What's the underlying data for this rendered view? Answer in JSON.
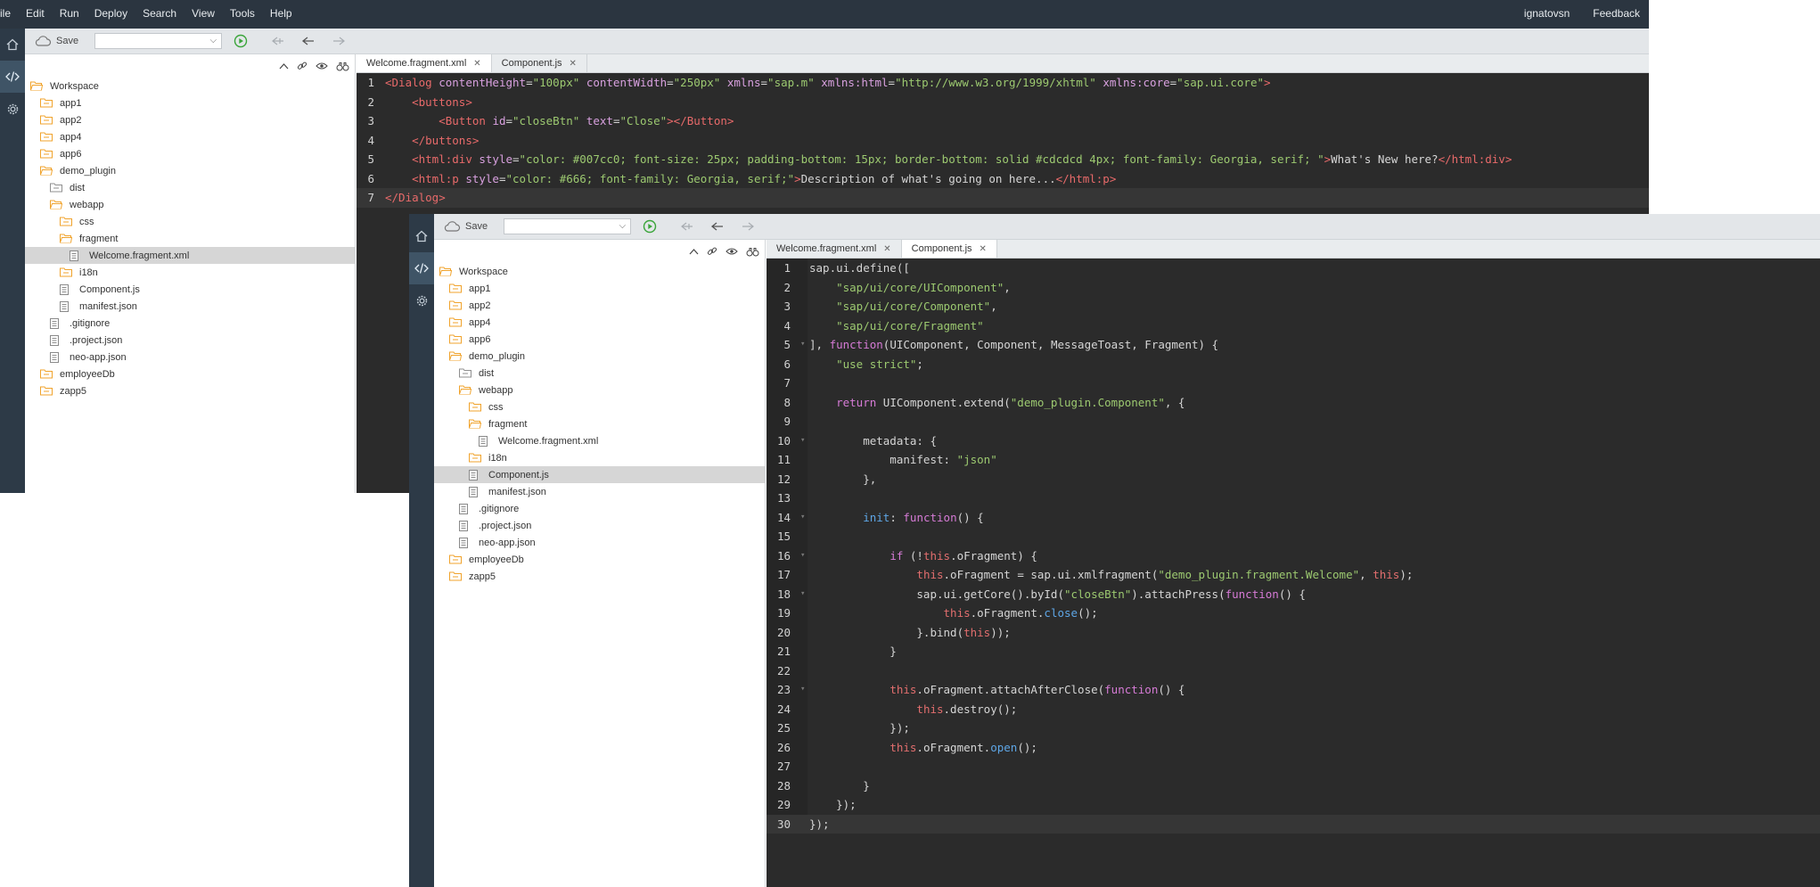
{
  "menubar": {
    "items": [
      "ile",
      "Edit",
      "Run",
      "Deploy",
      "Search",
      "View",
      "Tools",
      "Help"
    ],
    "user": "ignatovsn",
    "feedback": "Feedback"
  },
  "toolbar": {
    "save_label": "Save"
  },
  "tree": [
    {
      "label": "Workspace",
      "type": "folder-open",
      "level": 0
    },
    {
      "label": "app1",
      "type": "folder",
      "level": 1
    },
    {
      "label": "app2",
      "type": "folder",
      "level": 1
    },
    {
      "label": "app4",
      "type": "folder",
      "level": 1
    },
    {
      "label": "app6",
      "type": "folder",
      "level": 1
    },
    {
      "label": "demo_plugin",
      "type": "folder-open",
      "level": 1
    },
    {
      "label": "dist",
      "type": "folder-gray",
      "level": 2
    },
    {
      "label": "webapp",
      "type": "folder-open",
      "level": 2
    },
    {
      "label": "css",
      "type": "folder",
      "level": 3
    },
    {
      "label": "fragment",
      "type": "folder-open",
      "level": 3
    },
    {
      "label": "Welcome.fragment.xml",
      "type": "file",
      "level": 4
    },
    {
      "label": "i18n",
      "type": "folder",
      "level": 3
    },
    {
      "label": "Component.js",
      "type": "file",
      "level": 3
    },
    {
      "label": "manifest.json",
      "type": "file",
      "level": 3
    },
    {
      "label": ".gitignore",
      "type": "file",
      "level": 2
    },
    {
      "label": ".project.json",
      "type": "file",
      "level": 2
    },
    {
      "label": "neo-app.json",
      "type": "file",
      "level": 2
    },
    {
      "label": "employeeDb",
      "type": "folder",
      "level": 1
    },
    {
      "label": "zapp5",
      "type": "folder",
      "level": 1
    }
  ],
  "window1": {
    "selected_tree_index": 10,
    "tabs": [
      {
        "label": "Welcome.fragment.xml",
        "active": true
      },
      {
        "label": "Component.js",
        "active": false
      }
    ],
    "current_line": 7,
    "code": [
      [
        [
          "tag",
          "<Dialog "
        ],
        [
          "attr",
          "contentHeight"
        ],
        [
          "plain",
          "="
        ],
        [
          "str",
          "\"100px\""
        ],
        [
          "plain",
          " "
        ],
        [
          "attr",
          "contentWidth"
        ],
        [
          "plain",
          "="
        ],
        [
          "str",
          "\"250px\""
        ],
        [
          "plain",
          " "
        ],
        [
          "attr",
          "xmlns"
        ],
        [
          "plain",
          "="
        ],
        [
          "str",
          "\"sap.m\""
        ],
        [
          "plain",
          " "
        ],
        [
          "attr",
          "xmlns:html"
        ],
        [
          "plain",
          "="
        ],
        [
          "str",
          "\"http://www.w3.org/1999/xhtml\""
        ],
        [
          "plain",
          " "
        ],
        [
          "attr",
          "xmlns:core"
        ],
        [
          "plain",
          "="
        ],
        [
          "str",
          "\"sap.ui.core\""
        ],
        [
          "tag",
          ">"
        ]
      ],
      [
        [
          "plain",
          "    "
        ],
        [
          "tag",
          "<buttons>"
        ]
      ],
      [
        [
          "plain",
          "        "
        ],
        [
          "tag",
          "<Button "
        ],
        [
          "attr",
          "id"
        ],
        [
          "plain",
          "="
        ],
        [
          "str",
          "\"closeBtn\""
        ],
        [
          "plain",
          " "
        ],
        [
          "attr",
          "text"
        ],
        [
          "plain",
          "="
        ],
        [
          "str",
          "\"Close\""
        ],
        [
          "tag",
          "></Button>"
        ]
      ],
      [
        [
          "plain",
          "    "
        ],
        [
          "tag",
          "</buttons>"
        ]
      ],
      [
        [
          "plain",
          "    "
        ],
        [
          "tag",
          "<html:div "
        ],
        [
          "attr",
          "style"
        ],
        [
          "plain",
          "="
        ],
        [
          "str",
          "\"color: #007cc0; font-size: 25px; padding-bottom: 15px; border-bottom: solid #cdcdcd 4px; font-family: Georgia, serif; \""
        ],
        [
          "tag",
          ">"
        ],
        [
          "plain",
          "What's New here?"
        ],
        [
          "tag",
          "</html:div>"
        ]
      ],
      [
        [
          "plain",
          "    "
        ],
        [
          "tag",
          "<html:p "
        ],
        [
          "attr",
          "style"
        ],
        [
          "plain",
          "="
        ],
        [
          "str",
          "\"color: #666; font-family: Georgia, serif;\""
        ],
        [
          "tag",
          ">"
        ],
        [
          "plain",
          "Description of what's going on here..."
        ],
        [
          "tag",
          "</html:p>"
        ]
      ],
      [
        [
          "tag",
          "</Dialog>"
        ]
      ]
    ]
  },
  "window2": {
    "selected_tree_index": 12,
    "tabs": [
      {
        "label": "Welcome.fragment.xml",
        "active": false
      },
      {
        "label": "Component.js",
        "active": true
      }
    ],
    "current_line": 30,
    "code": [
      [
        [
          "plain",
          "sap.ui.define(["
        ]
      ],
      [
        [
          "plain",
          "    "
        ],
        [
          "str",
          "\"sap/ui/core/UIComponent\""
        ],
        [
          "plain",
          ","
        ]
      ],
      [
        [
          "plain",
          "    "
        ],
        [
          "str",
          "\"sap/ui/core/Component\""
        ],
        [
          "plain",
          ","
        ]
      ],
      [
        [
          "plain",
          "    "
        ],
        [
          "str",
          "\"sap/ui/core/Fragment\""
        ]
      ],
      [
        [
          "plain",
          "], "
        ],
        [
          "kw",
          "function"
        ],
        [
          "plain",
          "(UIComponent, Component, MessageToast, Fragment) {"
        ]
      ],
      [
        [
          "plain",
          "    "
        ],
        [
          "str",
          "\"use strict\""
        ],
        [
          "plain",
          ";"
        ]
      ],
      [
        [
          "plain",
          ""
        ]
      ],
      [
        [
          "plain",
          "    "
        ],
        [
          "kw",
          "return"
        ],
        [
          "plain",
          " UIComponent.extend("
        ],
        [
          "str",
          "\"demo_plugin.Component\""
        ],
        [
          "plain",
          ", {"
        ]
      ],
      [
        [
          "plain",
          ""
        ]
      ],
      [
        [
          "plain",
          "        metadata: {"
        ]
      ],
      [
        [
          "plain",
          "            manifest: "
        ],
        [
          "str",
          "\"json\""
        ]
      ],
      [
        [
          "plain",
          "        },"
        ]
      ],
      [
        [
          "plain",
          ""
        ]
      ],
      [
        [
          "plain",
          "        "
        ],
        [
          "fn",
          "init"
        ],
        [
          "plain",
          ": "
        ],
        [
          "kw",
          "function"
        ],
        [
          "plain",
          "() {"
        ]
      ],
      [
        [
          "plain",
          ""
        ]
      ],
      [
        [
          "plain",
          "            "
        ],
        [
          "kw",
          "if"
        ],
        [
          "plain",
          " (!"
        ],
        [
          "this",
          "this"
        ],
        [
          "plain",
          ".oFragment) {"
        ]
      ],
      [
        [
          "plain",
          "                "
        ],
        [
          "this",
          "this"
        ],
        [
          "plain",
          ".oFragment = sap.ui.xmlfragment("
        ],
        [
          "str",
          "\"demo_plugin.fragment.Welcome\""
        ],
        [
          "plain",
          ", "
        ],
        [
          "this",
          "this"
        ],
        [
          "plain",
          ");"
        ]
      ],
      [
        [
          "plain",
          "                sap.ui.getCore().byId("
        ],
        [
          "str",
          "\"closeBtn\""
        ],
        [
          "plain",
          ").attachPress("
        ],
        [
          "kw",
          "function"
        ],
        [
          "plain",
          "() {"
        ]
      ],
      [
        [
          "plain",
          "                    "
        ],
        [
          "this",
          "this"
        ],
        [
          "plain",
          ".oFragment."
        ],
        [
          "fn",
          "close"
        ],
        [
          "plain",
          "();"
        ]
      ],
      [
        [
          "plain",
          "                }.bind("
        ],
        [
          "this",
          "this"
        ],
        [
          "plain",
          "));"
        ]
      ],
      [
        [
          "plain",
          "            }"
        ]
      ],
      [
        [
          "plain",
          ""
        ]
      ],
      [
        [
          "plain",
          "            "
        ],
        [
          "this",
          "this"
        ],
        [
          "plain",
          ".oFragment.attachAfterClose("
        ],
        [
          "kw",
          "function"
        ],
        [
          "plain",
          "() {"
        ]
      ],
      [
        [
          "plain",
          "                "
        ],
        [
          "this",
          "this"
        ],
        [
          "plain",
          ".destroy();"
        ]
      ],
      [
        [
          "plain",
          "            });"
        ]
      ],
      [
        [
          "plain",
          "            "
        ],
        [
          "this",
          "this"
        ],
        [
          "plain",
          ".oFragment."
        ],
        [
          "fn",
          "open"
        ],
        [
          "plain",
          "();"
        ]
      ],
      [
        [
          "plain",
          ""
        ]
      ],
      [
        [
          "plain",
          "        }"
        ]
      ],
      [
        [
          "plain",
          "    });"
        ]
      ],
      [
        [
          "plain",
          "});"
        ]
      ]
    ],
    "fold_lines": [
      5,
      10,
      14,
      16,
      18,
      23
    ]
  },
  "colors": {
    "menubar": "#2b3540",
    "sidebar": "#2d3a47",
    "editor_bg": "#2b2b2b",
    "tag": "#e86a6a",
    "string": "#9cc970",
    "keyword": "#d67bd6",
    "function": "#5ea6e6",
    "folder": "#f0a32c"
  },
  "icons": {
    "sidebar": [
      "home-icon",
      "code-icon",
      "gear-icon"
    ],
    "toolbar": [
      "cloud-save-icon",
      "run-icon",
      "back-icon",
      "undo-icon",
      "forward-icon"
    ],
    "tree_tools": [
      "collapse-icon",
      "link-icon",
      "eye-icon",
      "binoculars-icon"
    ]
  }
}
